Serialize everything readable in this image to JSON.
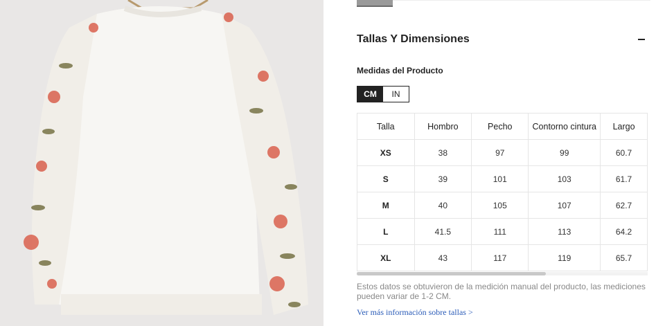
{
  "product_image": {
    "alt": "product-photo",
    "colors": {
      "background": "#e9e7e6",
      "sweatshirt": "#f7f6f3",
      "floral_red": "#d9604e",
      "floral_olive": "#6f6a3b"
    }
  },
  "size_panel": {
    "title": "Tallas Y Dimensiones",
    "subtitle": "Medidas del Producto",
    "unit_toggle": {
      "cm": "CM",
      "in": "IN",
      "selected": "CM"
    },
    "table": {
      "headers": [
        "Talla",
        "Hombro",
        "Pecho",
        "Contorno cintura",
        "Largo"
      ],
      "rows": [
        [
          "XS",
          "38",
          "97",
          "99",
          "60.7"
        ],
        [
          "S",
          "39",
          "101",
          "103",
          "61.7"
        ],
        [
          "M",
          "40",
          "105",
          "107",
          "62.7"
        ],
        [
          "L",
          "41.5",
          "111",
          "113",
          "64.2"
        ],
        [
          "XL",
          "43",
          "117",
          "119",
          "65.7"
        ]
      ]
    },
    "note": "Estos datos se obtuvieron de la medición manual del producto, las mediciones pueden variar de 1-2 CM.",
    "more_link": "Ver más información sobre tallas >"
  }
}
